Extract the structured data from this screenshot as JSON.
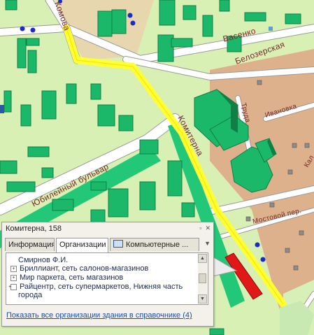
{
  "map": {
    "streets": [
      "Комова",
      "Васенко",
      "Белозерская",
      "Труда",
      "Ивановка",
      "Комитерна",
      "Юбилейный бульвар",
      "Мостовой пер.",
      "Кал"
    ]
  },
  "popup": {
    "title": "Комитерна, 158",
    "tabs": [
      {
        "label": "Информация",
        "active": false
      },
      {
        "label": "Организации",
        "active": true
      },
      {
        "label": "Компьютерные ...",
        "active": false,
        "icon": "monitor-icon"
      }
    ],
    "organizations": [
      "Смирнов Ф.И.",
      "Бриллиант, сеть салонов-магазинов",
      "Мир паркета, сеть магазинов",
      "Райцентр, сеть супермаркетов, Нижняя часть города"
    ],
    "show_all_link": "Показать все организации здания в справочнике",
    "show_all_count": "(4)"
  },
  "colors": {
    "background": "#d9f0b5",
    "building": "#1bb86a",
    "building_dark": "#0f7f45",
    "district": "#d9b08a",
    "highlight_road": "#ffff33",
    "selected_building": "#e01818",
    "link": "#1a4fa8"
  }
}
